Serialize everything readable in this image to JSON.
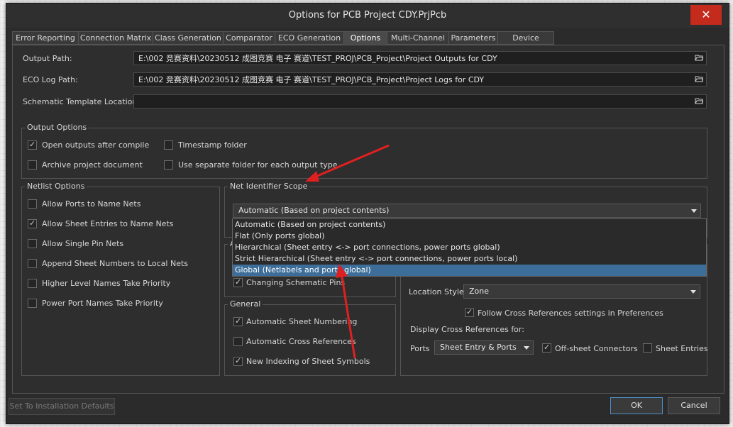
{
  "dialog": {
    "title": "Options for PCB Project CDY.PrjPcb",
    "close_label": "✕"
  },
  "tabs": [
    {
      "label": "Error Reporting"
    },
    {
      "label": "Connection Matrix"
    },
    {
      "label": "Class Generation"
    },
    {
      "label": "Comparator"
    },
    {
      "label": "ECO Generation"
    },
    {
      "label": "Options"
    },
    {
      "label": "Multi-Channel"
    },
    {
      "label": "Parameters"
    },
    {
      "label": "Device Sheets"
    }
  ],
  "paths": {
    "output_label": "Output Path:",
    "output_value": "E:\\002 竞赛资料\\20230512 成图竞赛 电子 赛道\\TEST_PROJ\\PCB_Project\\Project Outputs for CDY",
    "eco_label": "ECO Log Path:",
    "eco_value": "E:\\002 竞赛资料\\20230512 成图竞赛 电子 赛道\\TEST_PROJ\\PCB_Project\\Project Logs for CDY",
    "template_label": "Schematic Template Location:",
    "template_value": ""
  },
  "output_options": {
    "title": "Output Options",
    "items": [
      {
        "label": "Open outputs after compile",
        "checked": true
      },
      {
        "label": "Timestamp folder",
        "checked": false
      },
      {
        "label": "Archive project document",
        "checked": false
      },
      {
        "label": "Use separate folder for each output type",
        "checked": false
      }
    ]
  },
  "netlist_options": {
    "title": "Netlist Options",
    "items": [
      {
        "label": "Allow Ports to Name Nets",
        "checked": false
      },
      {
        "label": "Allow Sheet Entries to Name Nets",
        "checked": true
      },
      {
        "label": "Allow Single Pin Nets",
        "checked": false
      },
      {
        "label": "Append Sheet Numbers to Local Nets",
        "checked": false
      },
      {
        "label": "Higher Level Names Take Priority",
        "checked": false
      },
      {
        "label": "Power Port Names Take Priority",
        "checked": false
      }
    ]
  },
  "net_identifier": {
    "title": "Net Identifier Scope",
    "selected": "Automatic (Based on project contents)",
    "options": [
      "Automatic (Based on project contents)",
      "Flat (Only ports global)",
      "Hierarchical (Sheet entry <-> port connections, power ports global)",
      "Strict Hierarchical (Sheet entry <-> port connections, power ports local)",
      "Global (Netlabels and ports global)"
    ],
    "highlighted_index": 4
  },
  "partial_group": {
    "title": "A",
    "item": {
      "label": "Changing Schematic Pins",
      "checked": true
    }
  },
  "general": {
    "title": "General",
    "items": [
      {
        "label": "Automatic Sheet Numbering",
        "checked": true
      },
      {
        "label": "Automatic Cross References",
        "checked": false
      },
      {
        "label": "New Indexing of Sheet Symbols",
        "checked": true
      }
    ]
  },
  "cross_refs": {
    "location_style_label": "Location Style",
    "location_style_value": "Zone",
    "follow_label": "Follow Cross References settings in Preferences",
    "follow_checked": true,
    "display_label": "Display Cross References for:",
    "ports_label": "Ports",
    "ports_value": "Sheet Entry & Ports",
    "offsheet_label": "Off-sheet Connectors",
    "offsheet_checked": true,
    "sheet_entries_label": "Sheet Entries",
    "sheet_entries_checked": false
  },
  "footer": {
    "defaults_label": "Set To Installation Defaults",
    "ok_label": "OK",
    "cancel_label": "Cancel"
  },
  "colors": {
    "selection": "#3d6e99",
    "annotation_arrow": "#e02020"
  }
}
